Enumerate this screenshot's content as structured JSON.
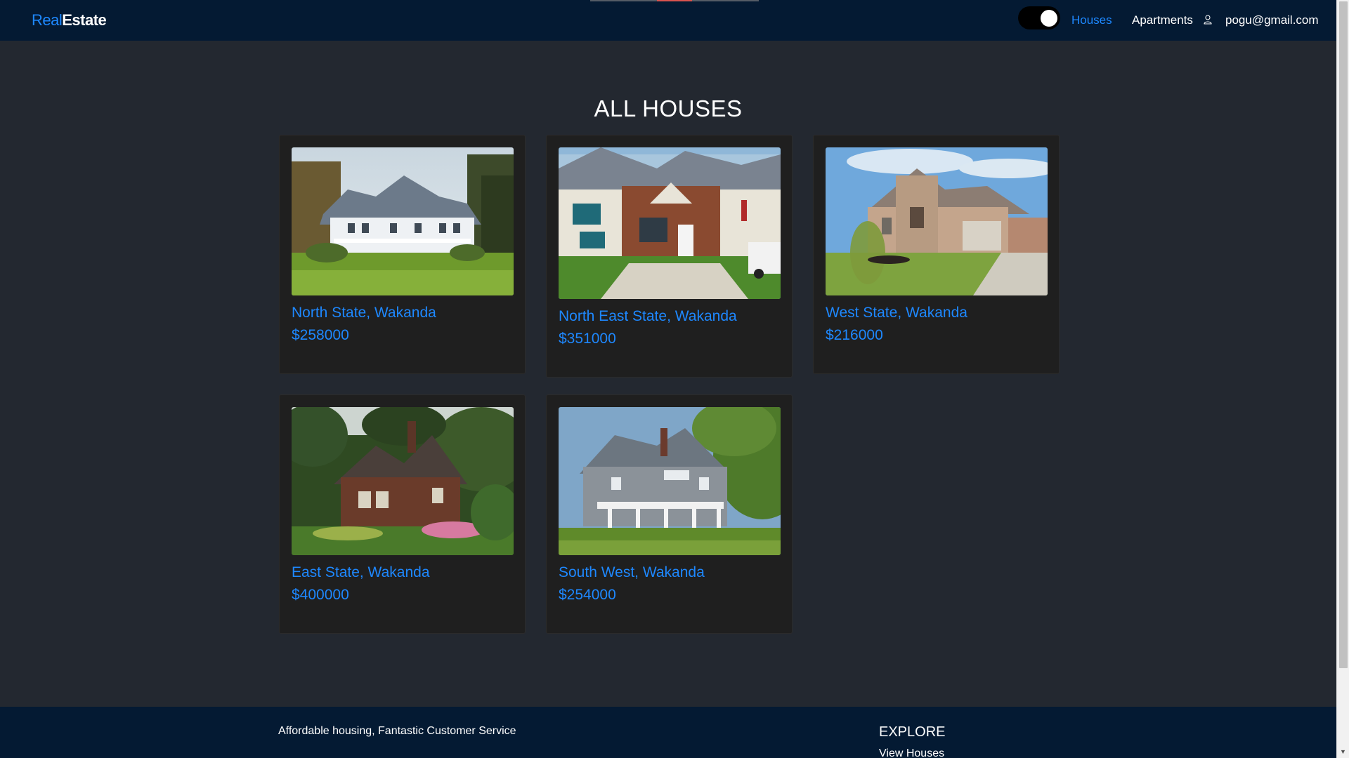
{
  "navbar": {
    "brand_part_1": "Real",
    "brand_part_2": "Estate",
    "links": [
      {
        "label": "Houses",
        "active": true
      },
      {
        "label": "Apartments",
        "active": false
      }
    ],
    "user_email": "pogu@gmail.com",
    "user_icon": "user-icon",
    "theme_toggle_on": true
  },
  "main": {
    "title": "ALL HOUSES",
    "listings": [
      {
        "location": "North State, Wakanda",
        "price": "$258000",
        "image": "house-white-farmhouse-photo"
      },
      {
        "location": "North East State, Wakanda",
        "price": "$351000",
        "image": "house-brick-colonial-photo"
      },
      {
        "location": "West State, Wakanda",
        "price": "$216000",
        "image": "house-stone-suburban-photo"
      },
      {
        "location": "East State, Wakanda",
        "price": "$400000",
        "image": "house-brick-cottage-photo"
      },
      {
        "location": "South West, Wakanda",
        "price": "$254000",
        "image": "house-grey-shingle-photo"
      }
    ]
  },
  "footer": {
    "tagline": "Affordable housing, Fantastic Customer Service",
    "explore_heading": "EXPLORE",
    "explore_link": "View Houses"
  },
  "colors": {
    "page_bg": "#232830",
    "navbar_bg": "#041a33",
    "card_bg": "#1f1f1f",
    "accent": "#1e88ff"
  }
}
